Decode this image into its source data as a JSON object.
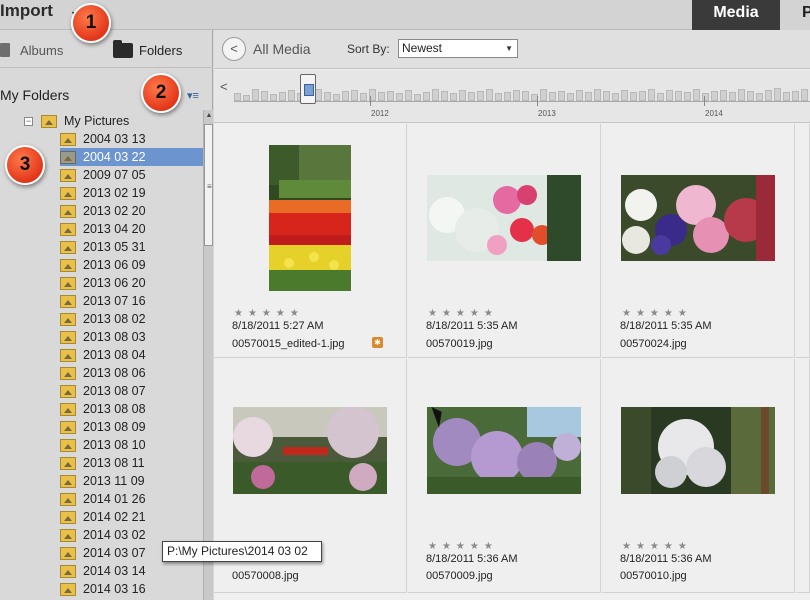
{
  "header": {
    "import_label": "Import",
    "import_arrow": "▼",
    "tabs": [
      {
        "label": "Media",
        "active": true
      },
      {
        "label": "P",
        "active": false
      }
    ]
  },
  "left_panel": {
    "tabs": {
      "albums": "Albums",
      "folders": "Folders"
    },
    "my_folders_title": "My Folders",
    "menu_icon": "▾≡",
    "tree": {
      "root": {
        "expander": "−",
        "label": "My Pictures"
      },
      "children": [
        "2004 03 13",
        "2004 03 22",
        "2009 07 05",
        "2013 02 19",
        "2013 02 20",
        "2013 04 20",
        "2013 05 31",
        "2013 06 09",
        "2013 06 20",
        "2013 07 16",
        "2013 08 02",
        "2013 08 03",
        "2013 08 04",
        "2013 08 06",
        "2013 08 07",
        "2013 08 08",
        "2013 08 09",
        "2013 08 10",
        "2013 08 11",
        "2013 11 09",
        "2014 01 26",
        "2014 02 21",
        "2014 03 02",
        "2014 03 07",
        "2014 03 14",
        "2014 03 16"
      ],
      "selected": "2004 03 22"
    }
  },
  "toolbar": {
    "back_icon": "<",
    "all_media": "All Media",
    "sort_by_label": "Sort By:",
    "sort_value": "Newest",
    "dropdown_arrow": "▼"
  },
  "timeline": {
    "left_arrow": "<",
    "years": [
      "2012",
      "2013",
      "2014"
    ]
  },
  "grid": {
    "star_glyphs": "★★★★★",
    "items": [
      {
        "date": "8/18/2011 5:27 AM",
        "filename": "00570015_edited-1.jpg",
        "edited": true
      },
      {
        "date": "8/18/2011 5:35 AM",
        "filename": "00570019.jpg",
        "edited": false
      },
      {
        "date": "8/18/2011 5:35 AM",
        "filename": "00570024.jpg",
        "edited": false
      },
      {
        "date": "",
        "filename": "00570008.jpg",
        "edited": false
      },
      {
        "date": "8/18/2011 5:36 AM",
        "filename": "00570009.jpg",
        "edited": false
      },
      {
        "date": "8/18/2011 5:36 AM",
        "filename": "00570010.jpg",
        "edited": false
      }
    ],
    "badge_glyph": "✱"
  },
  "tooltip": "P:\\My Pictures\\2014 03 02",
  "callouts": [
    "1",
    "2",
    "3"
  ]
}
